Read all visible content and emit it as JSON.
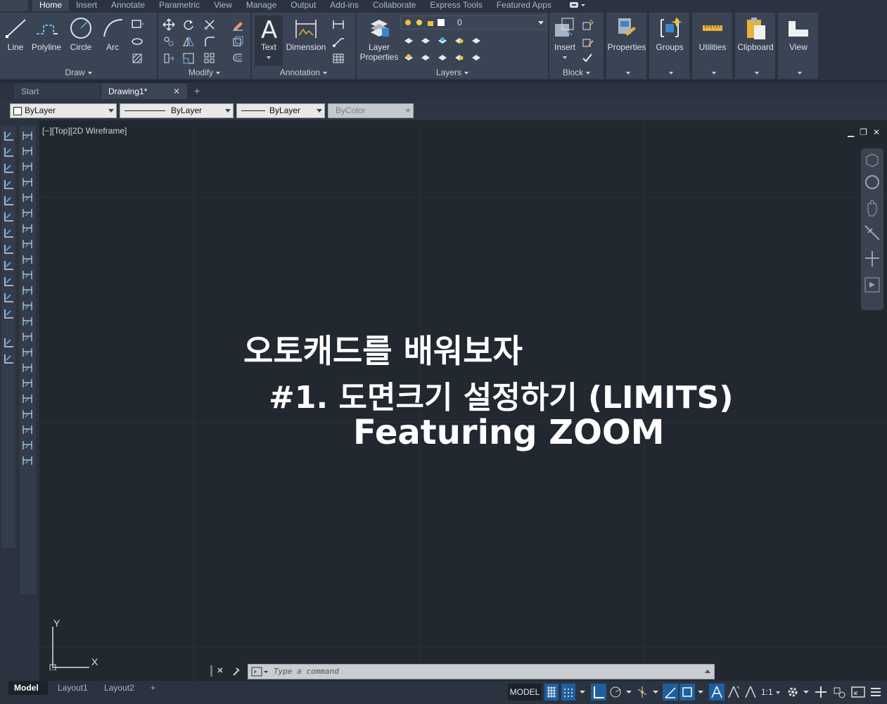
{
  "ribbon_tabs": [
    "Home",
    "Insert",
    "Annotate",
    "Parametric",
    "View",
    "Manage",
    "Output",
    "Add-ins",
    "Collaborate",
    "Express Tools",
    "Featured Apps"
  ],
  "draw": {
    "line": "Line",
    "polyline": "Polyline",
    "circle": "Circle",
    "arc": "Arc",
    "title": "Draw"
  },
  "modify": {
    "title": "Modify"
  },
  "annotation": {
    "text": "Text",
    "dimension": "Dimension",
    "title": "Annotation"
  },
  "layers": {
    "layer_properties": "Layer\nProperties",
    "current_layer": "0",
    "title": "Layers"
  },
  "block": {
    "insert": "Insert",
    "title": "Block"
  },
  "panels": {
    "properties": "Properties",
    "groups": "Groups",
    "utilities": "Utilities",
    "clipboard": "Clipboard",
    "view": "View"
  },
  "doc_tabs": {
    "start": "Start",
    "drawing": "Drawing1*",
    "close": "✕",
    "add": "+"
  },
  "property_bar": {
    "color": "ByLayer",
    "linetype": "ByLayer",
    "lineweight": "ByLayer",
    "plotstyle": "ByColor"
  },
  "viewport": {
    "label": "[−][Top][2D Wireframe]",
    "title_line1": "오토캐드를 배워보자",
    "title_line2": "#1.  도면크기 설정하기 (LIMITS)",
    "title_line3": "Featuring ZOOM",
    "ucs_x": "X",
    "ucs_y": "Y"
  },
  "command": {
    "placeholder": "Type  a  command"
  },
  "status": {
    "model_tab": "Model",
    "layout1": "Layout1",
    "layout2": "Layout2",
    "add": "+",
    "model": "MODEL",
    "scale": "1:1"
  }
}
